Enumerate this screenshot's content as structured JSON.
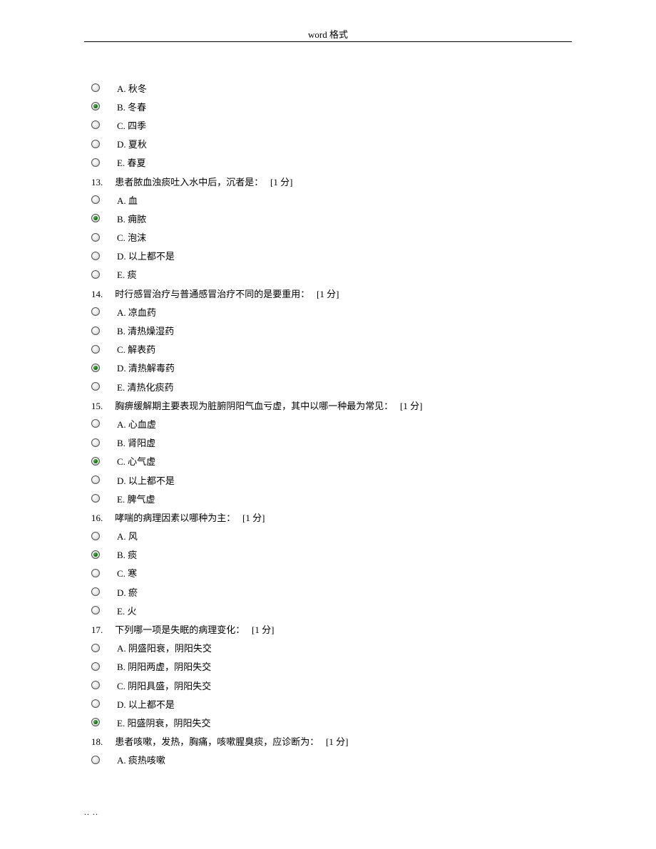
{
  "header": {
    "title": "word 格式"
  },
  "footer": {
    "text": ".. .."
  },
  "questions": [
    {
      "number": "",
      "text": "",
      "points": "",
      "options": [
        {
          "label": "A.",
          "text": "秋冬",
          "selected": false
        },
        {
          "label": "B.",
          "text": "冬春",
          "selected": true
        },
        {
          "label": "C.",
          "text": "四季",
          "selected": false
        },
        {
          "label": "D.",
          "text": "夏秋",
          "selected": false
        },
        {
          "label": "E.",
          "text": "春夏",
          "selected": false
        }
      ]
    },
    {
      "number": "13.",
      "text": "患者脓血浊痰吐入水中后，沉者是：",
      "points": "[1 分]",
      "options": [
        {
          "label": "A.",
          "text": "血",
          "selected": false
        },
        {
          "label": "B.",
          "text": "痈脓",
          "selected": true
        },
        {
          "label": "C.",
          "text": "泡沫",
          "selected": false
        },
        {
          "label": "D.",
          "text": "以上都不是",
          "selected": false
        },
        {
          "label": "E.",
          "text": "痰",
          "selected": false
        }
      ]
    },
    {
      "number": "14.",
      "text": "时行感冒治疗与普通感冒治疗不同的是要重用：",
      "points": "[1 分]",
      "options": [
        {
          "label": "A.",
          "text": "凉血药",
          "selected": false
        },
        {
          "label": "B.",
          "text": "清热燥湿药",
          "selected": false
        },
        {
          "label": "C.",
          "text": "解表药",
          "selected": false
        },
        {
          "label": "D.",
          "text": "清热解毒药",
          "selected": true
        },
        {
          "label": "E.",
          "text": "清热化痰药",
          "selected": false
        }
      ]
    },
    {
      "number": "15.",
      "text": "胸痹缓解期主要表现为脏腑阴阳气血亏虚，其中以哪一种最为常见：",
      "points": "[1 分]",
      "options": [
        {
          "label": "A.",
          "text": "心血虚",
          "selected": false
        },
        {
          "label": "B.",
          "text": "肾阳虚",
          "selected": false
        },
        {
          "label": "C.",
          "text": "心气虚",
          "selected": true
        },
        {
          "label": "D.",
          "text": "以上都不是",
          "selected": false
        },
        {
          "label": "E.",
          "text": "脾气虚",
          "selected": false
        }
      ]
    },
    {
      "number": "16.",
      "text": "哮喘的病理因素以哪种为主：",
      "points": "[1 分]",
      "options": [
        {
          "label": "A.",
          "text": "风",
          "selected": false
        },
        {
          "label": "B.",
          "text": "痰",
          "selected": true
        },
        {
          "label": "C.",
          "text": "寒",
          "selected": false
        },
        {
          "label": "D.",
          "text": "瘀",
          "selected": false
        },
        {
          "label": "E.",
          "text": "火",
          "selected": false
        }
      ]
    },
    {
      "number": "17.",
      "text": "下列哪一项是失眠的病理变化：",
      "points": "[1 分]",
      "options": [
        {
          "label": "A.",
          "text": "阴盛阳衰，阴阳失交",
          "selected": false
        },
        {
          "label": "B.",
          "text": "阴阳两虚，阴阳失交",
          "selected": false
        },
        {
          "label": "C.",
          "text": "阴阳具盛，阴阳失交",
          "selected": false
        },
        {
          "label": "D.",
          "text": "以上都不是",
          "selected": false
        },
        {
          "label": "E.",
          "text": "阳盛阴衰，阴阳失交",
          "selected": true
        }
      ]
    },
    {
      "number": "18.",
      "text": "患者咳嗽，发热，胸痛，咳嗽腥臭痰，应诊断为：",
      "points": "[1 分]",
      "options": [
        {
          "label": "A.",
          "text": "痰热咳嗽",
          "selected": false
        }
      ]
    }
  ]
}
